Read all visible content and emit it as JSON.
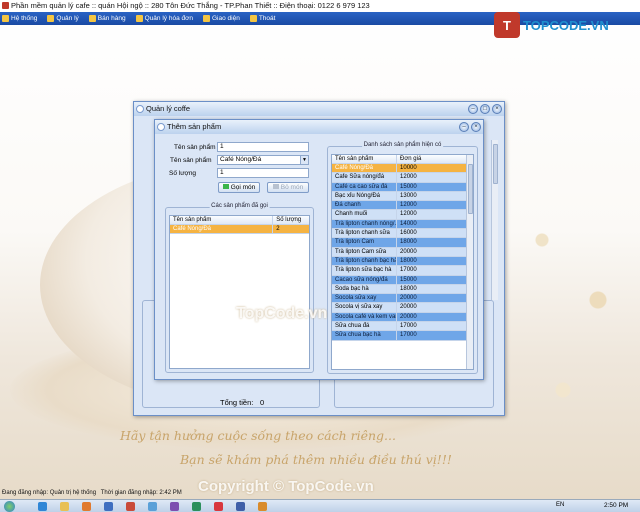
{
  "app": {
    "title": "Phần mềm quản lý cafe :: quán Hội ngộ :: 280 Tôn Đức Thắng - TP.Phan Thiết :: Điện thoại: 0122 6 979 123"
  },
  "menu": [
    {
      "label": "Hệ thống",
      "icon": "system-icon"
    },
    {
      "label": "Quản lý",
      "icon": "manage-icon"
    },
    {
      "label": "Bán hàng",
      "icon": "sales-icon"
    },
    {
      "label": "Quản lý hóa đơn",
      "icon": "invoice-icon"
    },
    {
      "label": "Giao diện",
      "icon": "theme-icon"
    },
    {
      "label": "Thoát",
      "icon": "exit-icon"
    }
  ],
  "logo": {
    "mark": "T",
    "text": "TOPCODE.VN"
  },
  "outer_window": {
    "title": "Quản lý coffe",
    "total_label": "Tổng tiền:",
    "total_value": "0",
    "left_partial_label": "Tê"
  },
  "dialog": {
    "title": "Thêm sản phẩm",
    "product_name_label": "Tên sản phẩm",
    "product_name_value": "1",
    "product_select_label": "Tên sản phẩm",
    "product_select_value": "Café Nóng/Đá",
    "quantity_label": "Số lượng",
    "quantity_value": "1",
    "order_button": "Gọi món",
    "remove_button": "Bỏ món",
    "ordered_group": "Các sản phẩm đã gọi",
    "ordered_columns": [
      "Tên sản phẩm",
      "Số lượng"
    ],
    "ordered_rows": [
      {
        "name": "Café Nóng/Đá",
        "qty": "2"
      }
    ],
    "list_group": "Danh sách sản phẩm hiện có",
    "list_columns": [
      "Tên sản phẩm",
      "Đơn giá"
    ],
    "list_rows": [
      {
        "name": "Café Nóng/Đá",
        "price": "10000"
      },
      {
        "name": "Cafe Sữa nóng/đá",
        "price": "12000"
      },
      {
        "name": "Café ca cao sữa đá",
        "price": "15000"
      },
      {
        "name": "Bạc xỉu Nóng/Đá",
        "price": "13000"
      },
      {
        "name": "Đá chanh",
        "price": "12000"
      },
      {
        "name": "Chanh muối",
        "price": "12000"
      },
      {
        "name": "Trà lipton chanh nóng/...",
        "price": "14000"
      },
      {
        "name": "Trà lipton chanh sữa",
        "price": "16000"
      },
      {
        "name": "Trà lipton Cam",
        "price": "18000"
      },
      {
        "name": "Trà lipton Cam sữa",
        "price": "20000"
      },
      {
        "name": "Trà lipton chanh bạc hà",
        "price": "18000"
      },
      {
        "name": "Trà lipton sữa bạc hà",
        "price": "17000"
      },
      {
        "name": "Cacao sữa nóng/đá",
        "price": "15000"
      },
      {
        "name": "Soda bạc hà",
        "price": "18000"
      },
      {
        "name": "Socola sữa xay",
        "price": "20000"
      },
      {
        "name": "Socola vị sữa xay",
        "price": "20000"
      },
      {
        "name": "Socola café và kem vani",
        "price": "20000"
      },
      {
        "name": "Sữa chua đá",
        "price": "17000"
      },
      {
        "name": "Sữa chua bạc hà",
        "price": "17000"
      }
    ]
  },
  "slogan": {
    "line1": "Hãy tận hưởng cuộc sống theo cách riêng...",
    "line2": "Bạn sẽ khám phá thêm nhiều điều thú vị!!!"
  },
  "watermarks": {
    "center": "TopCode.vn",
    "bottom": "Copyright © TopCode.vn"
  },
  "status": {
    "login_label": "Đang đăng nhập:",
    "login_value": "Quản trị hệ thống",
    "time_label": "Thời gian đăng nhập:",
    "time_value": "2:42 PM"
  },
  "taskbar": {
    "clock": "2:50 PM",
    "lang": "EN"
  },
  "colors": {
    "menubar": "#1a4aa3",
    "selected_row": "#f5b342",
    "row_dark": "#6fa6e8",
    "row_light": "#cfe0f6"
  }
}
